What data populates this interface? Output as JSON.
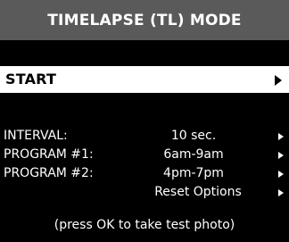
{
  "header": {
    "title": "TIMELAPSE (TL) MODE"
  },
  "start": {
    "label": "START"
  },
  "settings": {
    "interval": {
      "label": "INTERVAL:",
      "value": "10 sec."
    },
    "program1": {
      "label": "PROGRAM #1:",
      "value": "6am-9am"
    },
    "program2": {
      "label": "PROGRAM #2:",
      "value": "4pm-7pm"
    },
    "reset": {
      "label": "Reset Options"
    }
  },
  "hint": "(press OK to take test photo)",
  "colors": {
    "background": "#000000",
    "header": "#5a5a5a",
    "selected_bg": "#ffffff",
    "selected_text": "#000000",
    "text": "#ffffff"
  }
}
